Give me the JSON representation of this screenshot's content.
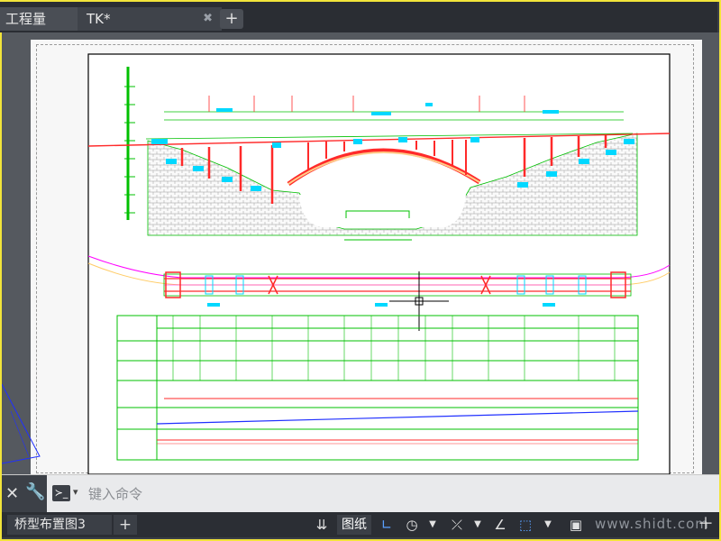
{
  "tabs": [
    {
      "label": "工程量",
      "active": true
    },
    {
      "label": "TK*",
      "active": false
    }
  ],
  "tab_close": "✖",
  "tab_add": "+",
  "command": {
    "placeholder": "键入命令",
    "prompt_icon": "≻_"
  },
  "layout_tab": "桥型布置图3",
  "layout_add": "+",
  "paper_label": "图纸",
  "watermark": "www.shidt.com",
  "colors": {
    "accent": "#f2e43a",
    "cad_green": "#00e600",
    "cad_red": "#ff2a2a",
    "cad_magenta": "#ff00ff",
    "cad_cyan": "#00d8ff",
    "cad_blue": "#2030ff"
  }
}
